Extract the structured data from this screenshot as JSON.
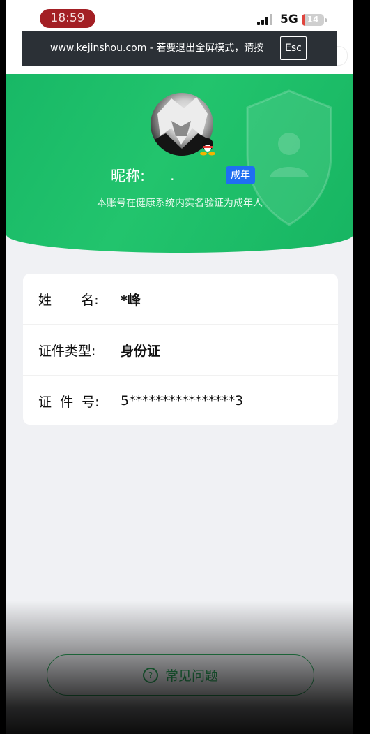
{
  "status_bar": {
    "time": "18:59",
    "network": "5G",
    "battery": "14",
    "battery_level": 0.14
  },
  "fullscreen_toast": {
    "message": "www.kejinshou.com - 若要退出全屏模式，请按",
    "key": "Esc"
  },
  "profile": {
    "nickname_label": "昵称:",
    "nickname_value": ".",
    "age_badge": "成年",
    "verify_text": "本账号在健康系统内实名验证为成年人"
  },
  "identity": {
    "rows": [
      {
        "label": "姓       名:",
        "value": "*峰"
      },
      {
        "label": "证件类型:",
        "value": "身份证"
      },
      {
        "label": "证  件  号:",
        "value": "5****************3"
      }
    ]
  },
  "faq": {
    "label": "常见问题"
  },
  "colors": {
    "header_green": "#1bbb68",
    "badge_blue": "#1f6ff2",
    "faq_green": "#2fa85e"
  }
}
